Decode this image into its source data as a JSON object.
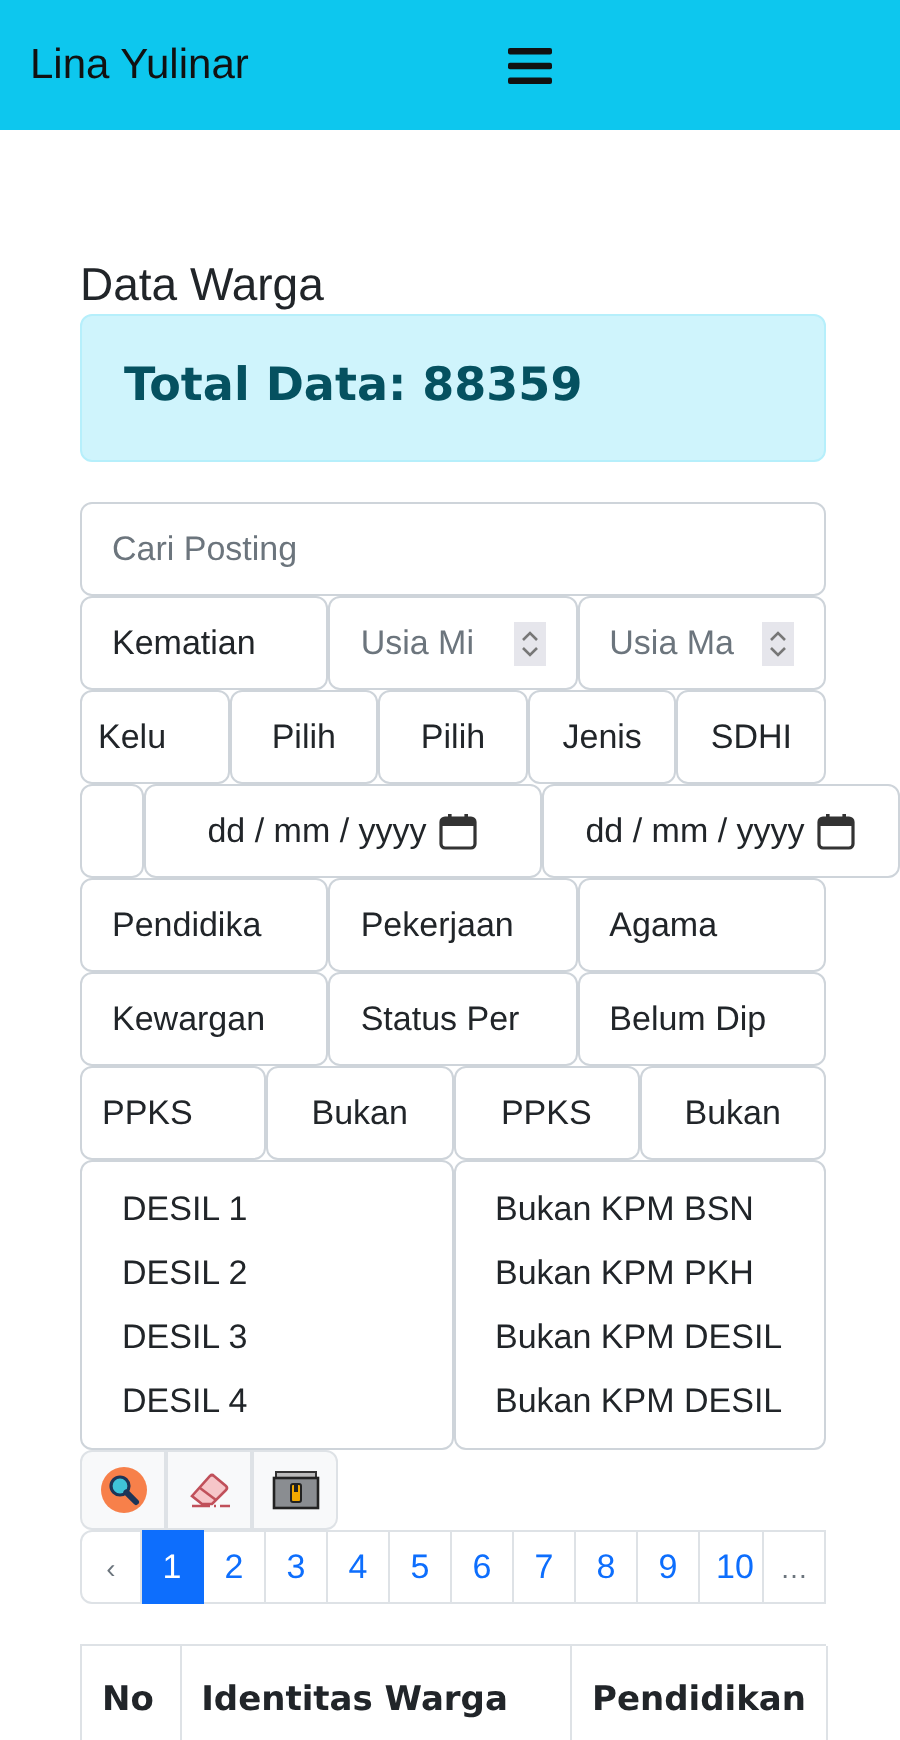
{
  "header": {
    "title": "Lina Yulinar"
  },
  "page_title": "Data Warga",
  "total": "Total Data: 88359",
  "search": {
    "placeholder": "Cari Posting"
  },
  "filter_rows": [
    [
      {
        "kind": "select",
        "value": "Kematian"
      },
      {
        "kind": "number",
        "placeholder": "Usia Mi"
      },
      {
        "kind": "number",
        "placeholder": "Usia Ma"
      }
    ],
    [
      {
        "kind": "select",
        "value": "Kelu"
      },
      {
        "kind": "select",
        "value": "Pilih"
      },
      {
        "kind": "select",
        "value": "Pilih"
      },
      {
        "kind": "select",
        "value": "Jenis"
      },
      {
        "kind": "select",
        "value": "SDHI"
      }
    ],
    [
      {
        "kind": "blank"
      },
      {
        "kind": "date",
        "value": "dd / mm / yyyy"
      },
      {
        "kind": "date",
        "value": "dd / mm / yyyy"
      }
    ],
    [
      {
        "kind": "select",
        "value": "Pendidika"
      },
      {
        "kind": "select",
        "value": "Pekerjaan"
      },
      {
        "kind": "select",
        "value": "Agama"
      }
    ],
    [
      {
        "kind": "select",
        "value": "Kewargan"
      },
      {
        "kind": "select",
        "value": "Status Per"
      },
      {
        "kind": "select",
        "value": "Belum Dip"
      }
    ],
    [
      {
        "kind": "select",
        "value": "PPKS"
      },
      {
        "kind": "select",
        "value": "Bukan"
      },
      {
        "kind": "select",
        "value": "PPKS"
      },
      {
        "kind": "select",
        "value": "Bukan"
      }
    ]
  ],
  "multi_selects": [
    [
      "DESIL 1",
      "DESIL 2",
      "DESIL 3",
      "DESIL 4"
    ],
    [
      "Bukan KPM BSN",
      "Bukan KPM PKH",
      "Bukan KPM DESIL",
      "Bukan KPM DESIL"
    ]
  ],
  "pagination": [
    {
      "label": "‹",
      "selected": false
    },
    {
      "label": "1",
      "selected": true
    },
    {
      "label": "2",
      "selected": false
    },
    {
      "label": "3",
      "selected": false
    },
    {
      "label": "4",
      "selected": false
    },
    {
      "label": "5",
      "selected": false
    },
    {
      "label": "6",
      "selected": false
    },
    {
      "label": "7",
      "selected": false
    },
    {
      "label": "8",
      "selected": false
    },
    {
      "label": "9",
      "selected": false
    },
    {
      "label": "10",
      "selected": false
    },
    {
      "label": "…",
      "selected": false
    }
  ],
  "table": {
    "columns": [
      "No",
      "Identitas Warga",
      "Pendidikan"
    ]
  }
}
